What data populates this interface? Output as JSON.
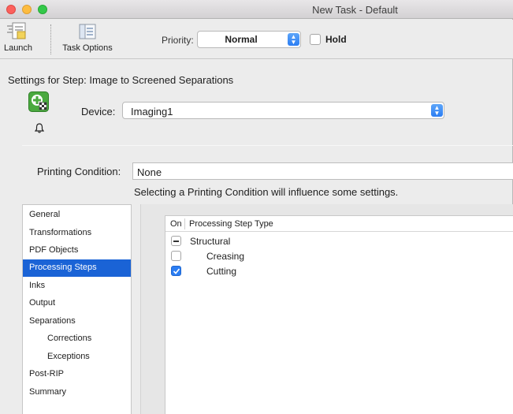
{
  "window": {
    "title": "New Task - Default"
  },
  "toolbar": {
    "launch_label": "Launch",
    "task_options_label": "Task Options",
    "priority_label": "Priority:",
    "priority_value": "Normal",
    "hold_label": "Hold",
    "hold_checked": false
  },
  "settings": {
    "title": "Settings for Step: Image to Screened Separations",
    "device_label": "Device:",
    "device_value": "Imaging1",
    "printing_condition_label": "Printing Condition:",
    "printing_condition_value": "None",
    "printing_condition_note": "Selecting a Printing Condition will influence some settings."
  },
  "nav": {
    "items": [
      {
        "label": "General",
        "selected": false,
        "indent": false
      },
      {
        "label": "Transformations",
        "selected": false,
        "indent": false
      },
      {
        "label": "PDF Objects",
        "selected": false,
        "indent": false
      },
      {
        "label": "Processing Steps",
        "selected": true,
        "indent": false
      },
      {
        "label": "Inks",
        "selected": false,
        "indent": false
      },
      {
        "label": "Output",
        "selected": false,
        "indent": false
      },
      {
        "label": "Separations",
        "selected": false,
        "indent": false
      },
      {
        "label": "Corrections",
        "selected": false,
        "indent": true
      },
      {
        "label": "Exceptions",
        "selected": false,
        "indent": true
      },
      {
        "label": "Post-RIP",
        "selected": false,
        "indent": false
      },
      {
        "label": "Summary",
        "selected": false,
        "indent": false
      }
    ]
  },
  "processing_table": {
    "col_on": "On",
    "col_type": "Processing Step Type",
    "rows": [
      {
        "label": "Structural",
        "state": "mixed",
        "indent": false
      },
      {
        "label": "Creasing",
        "state": "unchecked",
        "indent": true
      },
      {
        "label": "Cutting",
        "state": "checked",
        "indent": true
      }
    ]
  },
  "colors": {
    "selection": "#1a63d6",
    "checkbox_checked": "#2a7df3"
  }
}
